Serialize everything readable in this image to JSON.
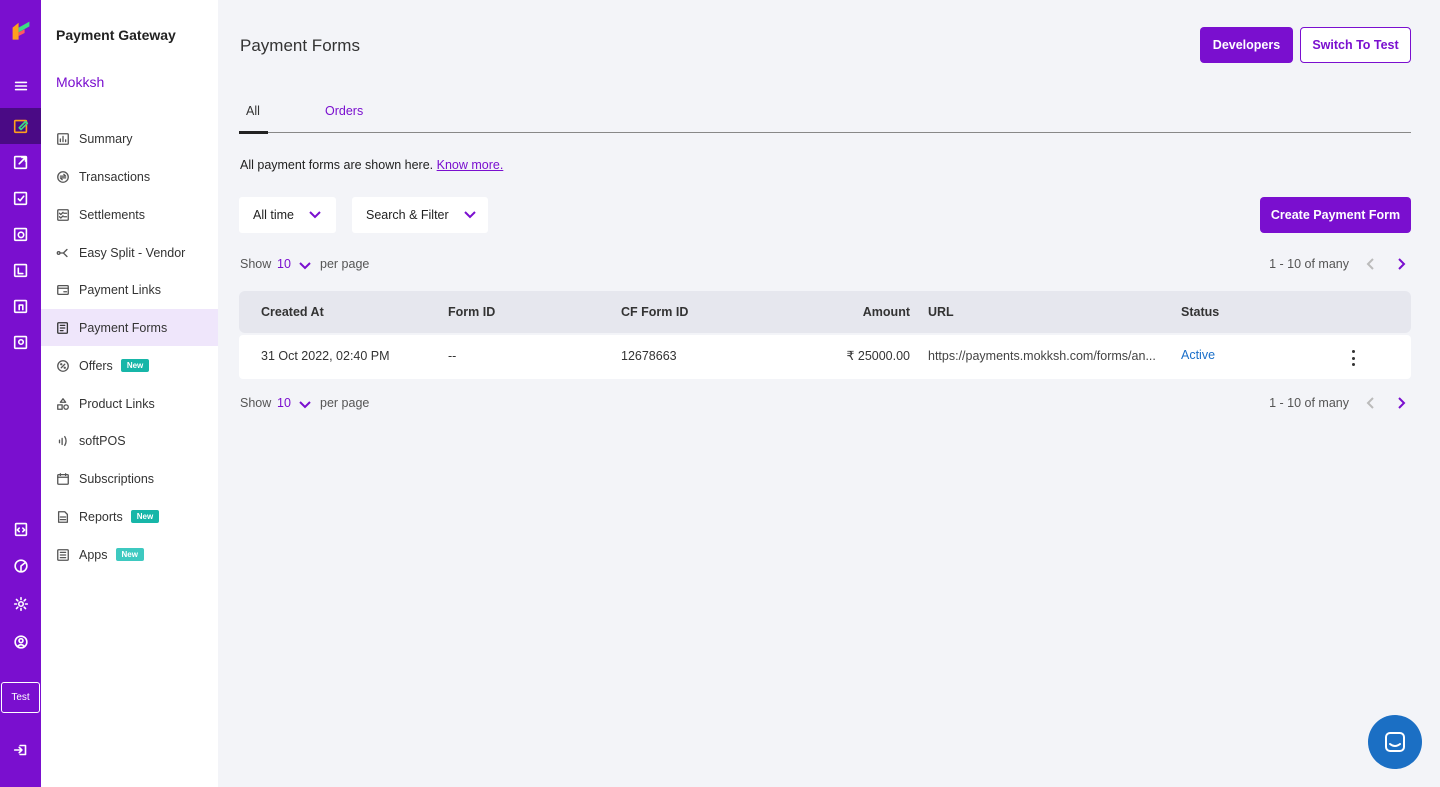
{
  "rail": {
    "test_label": "Test",
    "icons": [
      "logo-icon",
      "menu-icon",
      "payment-gateway-icon",
      "payouts-icon",
      "verification-icon",
      "subscriptions-icon",
      "forms-icon",
      "store-icon",
      "secure-id-icon",
      "developer-icon",
      "analytics-icon",
      "settings-icon",
      "profile-icon",
      "logout-icon"
    ]
  },
  "sidebar": {
    "product": "Payment Gateway",
    "merchant": "Mokksh",
    "items": [
      {
        "label": "Summary",
        "icon": "chart-icon"
      },
      {
        "label": "Transactions",
        "icon": "transactions-icon"
      },
      {
        "label": "Settlements",
        "icon": "settlements-icon"
      },
      {
        "label": "Easy Split - Vendor",
        "icon": "split-icon"
      },
      {
        "label": "Payment Links",
        "icon": "link-icon"
      },
      {
        "label": "Payment Forms",
        "icon": "form-icon",
        "active": true
      },
      {
        "label": "Offers",
        "icon": "offer-icon",
        "badge": "New"
      },
      {
        "label": "Product Links",
        "icon": "product-icon"
      },
      {
        "label": "softPOS",
        "icon": "nfc-icon"
      },
      {
        "label": "Subscriptions",
        "icon": "calendar-icon"
      },
      {
        "label": "Reports",
        "icon": "report-icon",
        "badge": "New"
      },
      {
        "label": "Apps",
        "icon": "apps-icon",
        "badge": "New"
      }
    ]
  },
  "header": {
    "title": "Payment Forms",
    "developers_label": "Developers",
    "switch_label": "Switch To Test"
  },
  "tabs": [
    {
      "label": "All",
      "active": true
    },
    {
      "label": "Orders"
    }
  ],
  "info": {
    "text": "All payment forms are shown here.",
    "link": "Know more."
  },
  "filters": {
    "time": "All time",
    "search": "Search & Filter"
  },
  "create_label": "Create Payment Form",
  "pagination": {
    "show": "Show",
    "per_page_value": "10",
    "per_page": "per page",
    "range": "1 - 10 of many"
  },
  "table": {
    "columns": [
      "Created At",
      "Form ID",
      "CF Form ID",
      "Amount",
      "URL",
      "Status"
    ],
    "rows": [
      {
        "created_at": "31 Oct 2022, 02:40 PM",
        "form_id": "--",
        "cf_form_id": "12678663",
        "amount": "₹ 25000.00",
        "url": "https://payments.mokksh.com/forms/an...",
        "status": "Active"
      }
    ]
  },
  "colors": {
    "primary": "#7a0fcf",
    "rail_active": "#4a0a85",
    "badge": "#17b6a8",
    "status_active": "#1a6fc9",
    "chat": "#1b6fc4"
  }
}
